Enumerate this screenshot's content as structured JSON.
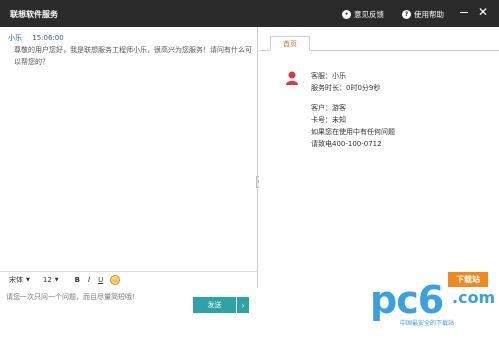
{
  "titlebar": {
    "title": "联想软件服务",
    "feedback_label": "意见反馈",
    "help_label": "使用帮助",
    "feedback_icon": "comment-icon",
    "help_icon": "question-icon"
  },
  "chat": {
    "message": {
      "sender": "小乐",
      "time": "15:06:00",
      "text": "尊敬的用户您好，我是联想服务工程师小乐，很高兴为您服务！请问有什么可以帮您的？"
    }
  },
  "toolbar": {
    "font_family": "宋体",
    "font_size": "12",
    "bold_label": "B",
    "italic_label": "I",
    "underline_label": "U",
    "emoji_icon": "smiley-icon"
  },
  "input": {
    "placeholder": "请您一次只问一个问题，而且尽量简短哦!"
  },
  "send_button": {
    "label": "发送",
    "arrow": "›"
  },
  "right_panel": {
    "tab_label": "首页",
    "agent_label": "客服：小乐",
    "service_duration": "服务时长：0时0分9秒",
    "customer_label": "客户：游客",
    "card_label": "卡号：未知",
    "notice_line1": "如果您在使用中有任何问题",
    "notice_line2": "请致电400-100-0712"
  },
  "watermark": {
    "brand": "pc6",
    "badge": "下载站",
    "domain": ".com",
    "slogan": "中国最安全的下载站"
  },
  "colors": {
    "titlebar_bg": "#2b2b2b",
    "accent_blue": "#1f5fbf",
    "tab_orange": "#e06b2c",
    "send_teal": "#2da3a6",
    "avatar_red": "#d9383a"
  }
}
